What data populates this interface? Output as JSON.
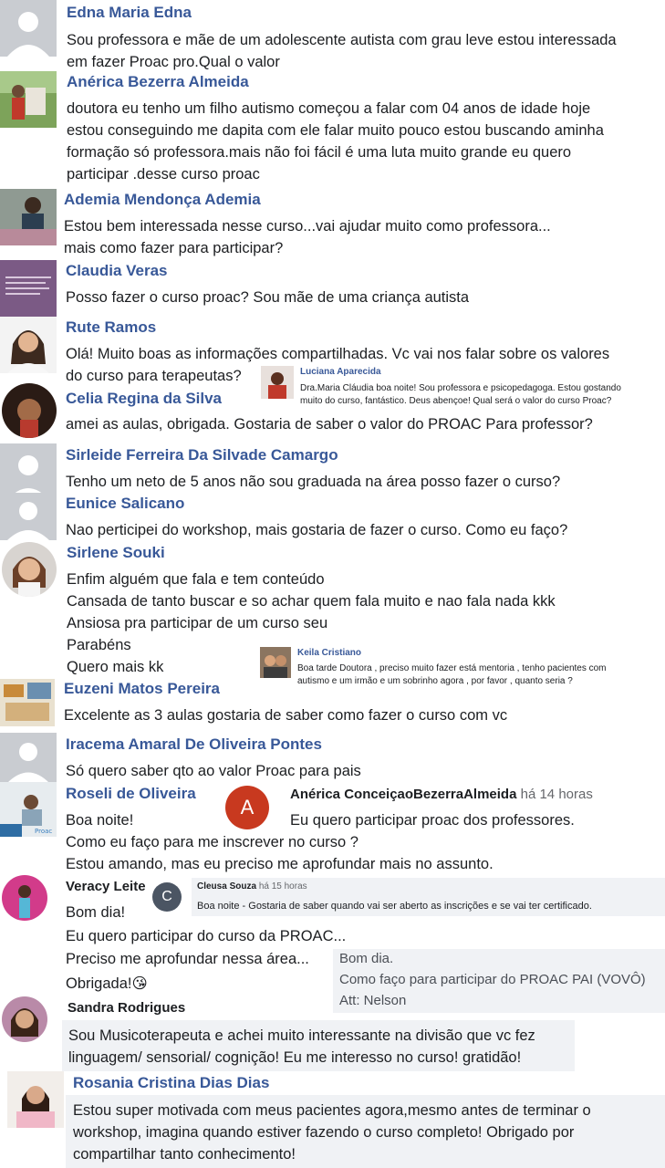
{
  "comments": [
    {
      "name": "Edna Maria Edna",
      "lines": [
        "Sou professora e mãe de um adolescente autista com grau leve estou interessada",
        "em fazer Proac pro.Qual o valor"
      ]
    },
    {
      "name": "Anérica Bezerra Almeida",
      "lines": [
        "doutora eu tenho um filho autismo começou a falar com 04 anos de idade hoje",
        "estou conseguindo me dapita com ele falar muito pouco estou buscando aminha",
        "formação só professora.mais não foi fácil é uma luta muito grande eu quero",
        "participar .desse curso proac"
      ]
    },
    {
      "name": "Ademia Mendonça Ademia",
      "lines": [
        "Estou bem interessada nesse curso...vai ajudar muito como professora...",
        "mais como fazer para participar?"
      ]
    },
    {
      "name": "Claudia Veras",
      "lines": [
        "Posso fazer o curso proac? Sou mãe de uma criança autista"
      ]
    },
    {
      "name": "Rute Ramos",
      "lines": [
        "Olá! Muito boas as informações compartilhadas. Vc vai nos falar sobre os valores",
        "do curso para terapeutas?"
      ]
    },
    {
      "name": "Celia Regina da Silva",
      "lines": [
        "amei as aulas, obrigada. Gostaria de saber o valor do PROAC Para professor?"
      ]
    },
    {
      "name": "Sirleide Ferreira Da Silvade Camargo",
      "lines": [
        "Tenho um neto de 5 anos não sou graduada na área posso fazer o curso?"
      ]
    },
    {
      "name": "Eunice Salicano",
      "lines": [
        "Nao perticipei do workshop, mais gostaria de fazer o curso. Como eu faço?"
      ]
    },
    {
      "name": "Sirlene Souki",
      "lines": [
        "Enfim alguém que fala e tem conteúdo",
        "Cansada de tanto buscar e so achar quem fala muito e nao fala nada kkk",
        "Ansiosa pra participar de um curso seu",
        "Parabéns",
        "Quero mais kk"
      ]
    },
    {
      "name": "Euzeni Matos Pereira",
      "lines": [
        "Excelente as 3 aulas gostaria de saber como fazer o curso com vc"
      ]
    },
    {
      "name": "Iracema Amaral De Oliveira Pontes",
      "lines": [
        "Só quero saber qto ao valor Proac para pais"
      ]
    },
    {
      "name": "Roseli de Oliveira",
      "lines": [
        "Boa noite!",
        "Como eu faço para me inscrever no curso ?",
        "Estou amando, mas eu preciso me aprofundar mais no assunto."
      ]
    },
    {
      "name": "Veracy Leite",
      "lines": [
        "Bom dia!",
        "Eu quero participar do curso da PROAC...",
        "Preciso me aprofundar nessa área...",
        "Obrigada!😘"
      ]
    },
    {
      "name": "Sandra Rodrigues",
      "lines": [
        "Sou Musicoterapeuta e achei muito interessante na divisão que vc fez",
        "linguagem/ sensorial/ cognição! Eu me interesso no curso! gratidão!"
      ]
    },
    {
      "name": "Rosania Cristina Dias Dias",
      "lines": [
        "Estou super motivada com meus pacientes agora,mesmo antes de terminar o",
        "workshop, imagina quando estiver fazendo o curso completo! Obrigado por",
        "compartilhar tanto conhecimento!"
      ]
    }
  ],
  "overlays": {
    "luciana": {
      "name": "Luciana Aparecida",
      "lines": [
        "Dra.Maria Cláudia boa noite! Sou professora e psicopedagoga. Estou gostando",
        "muito do curso, fantástico. Deus abençoe! Qual será o valor do curso Proac?"
      ]
    },
    "keila": {
      "name": "Keila Cristiano",
      "lines": [
        "Boa tarde Doutora , preciso muito fazer está mentoria , tenho pacientes com",
        "autismo e um irmão e um sobrinho agora , por favor , quanto seria ?"
      ]
    },
    "anerica2": {
      "avatar_letter": "A",
      "name": "Anérica ConceiçaoBezerraAlmeida",
      "time": "há 14 horas",
      "text": "Eu quero participar proac  dos  professores."
    },
    "cleusa": {
      "avatar_letter": "C",
      "name": "Cleusa Souza",
      "time": "há 15 horas",
      "text": "Boa noite - Gostaria de saber quando vai ser aberto as inscrições e se vai ter certificado."
    },
    "nelson": {
      "lines": [
        "Bom dia.",
        "Como faço para participar do PROAC PAI (VOVÔ)",
        "Att: Nelson"
      ]
    }
  },
  "colors": {
    "name_blue": "#385898",
    "bg_gray": "#f0f2f5",
    "avatar_red": "#c8391f",
    "avatar_slate": "#4b5563"
  }
}
